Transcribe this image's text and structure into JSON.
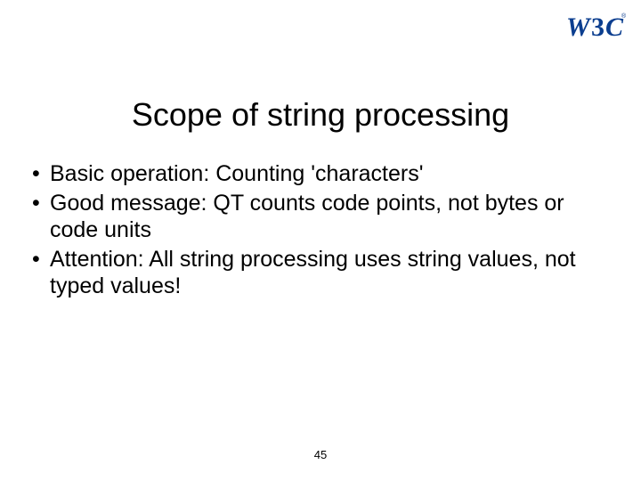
{
  "logo": {
    "alt": "W3C"
  },
  "title": "Scope of string processing",
  "bullets": [
    "Basic operation: Counting 'characters'",
    "Good message: QT counts code points, not bytes or code units",
    "Attention: All string processing uses string values, not typed values!"
  ],
  "pageNumber": "45"
}
